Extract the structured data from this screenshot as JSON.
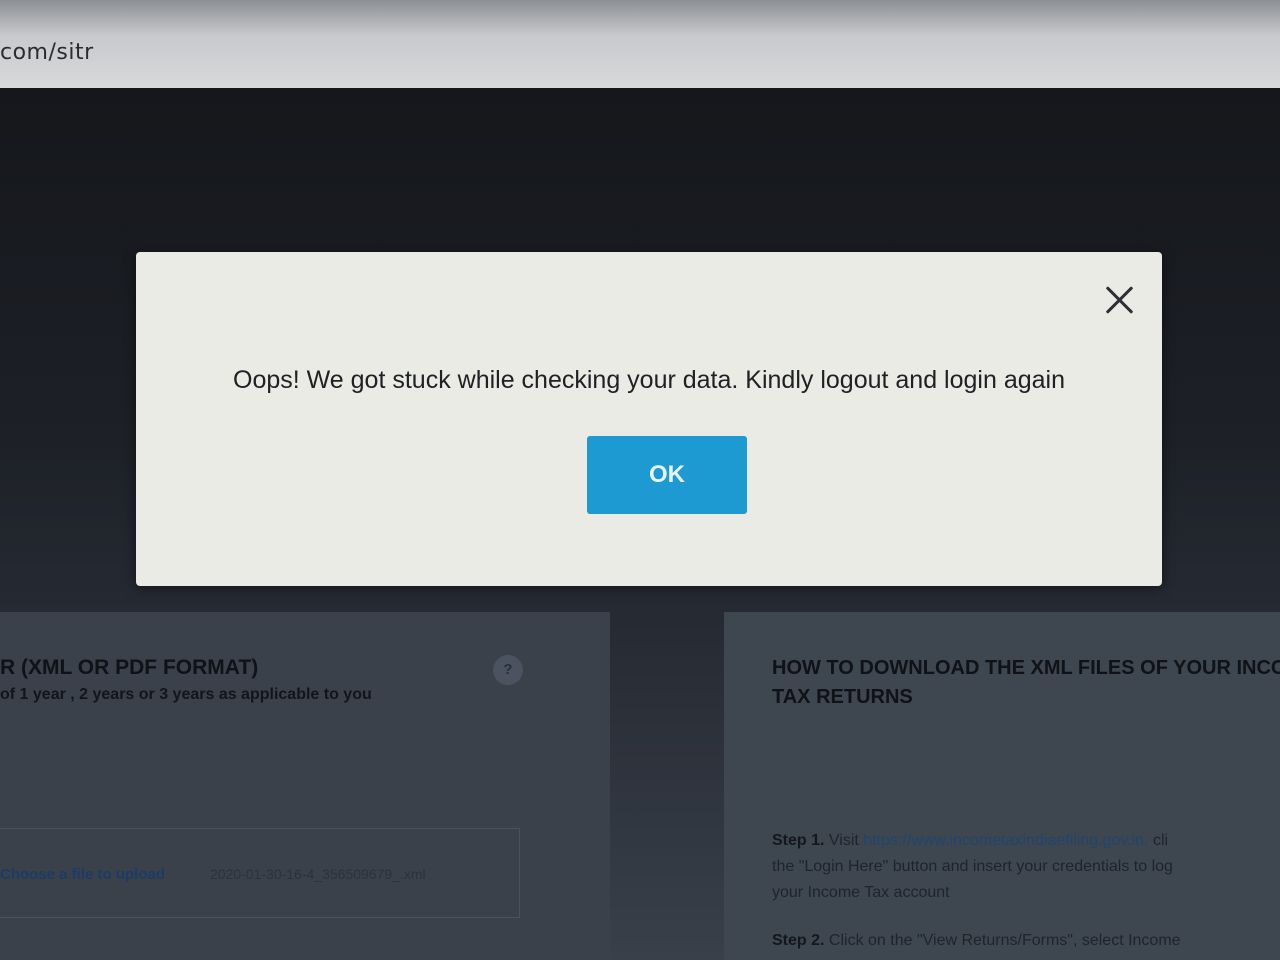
{
  "browser": {
    "url_fragment": "com/sitr"
  },
  "modal": {
    "message": "Oops! We got stuck while checking your data. Kindly logout and login again",
    "ok_label": "OK",
    "close_icon": "close-icon"
  },
  "upload_section": {
    "title": "R (XML OR PDF FORMAT)",
    "subtitle": "of 1 year , 2 years or 3 years as applicable to you",
    "help_label": "?",
    "choose_file_label": "Choose a file to upload",
    "file_name": "2020-01-30-16-4_356509679_.xml"
  },
  "howto_section": {
    "title_line1": "HOW TO DOWNLOAD THE XML FILES OF YOUR INCO",
    "title_line2": "TAX RETURNS",
    "step1_label": "Step 1.",
    "step1_text_a": "Visit",
    "step1_link": "https://www.incometaxindiaefiling.gov.in,",
    "step1_text_b": "cli",
    "step1_line2": "the \"Login Here\" button and insert your credentials to log",
    "step1_line3": "your Income Tax account",
    "step2_label": "Step 2.",
    "step2_text": "Click on the \"View Returns/Forms\", select Income"
  },
  "colors": {
    "ok_button": "#1c9ad1",
    "modal_bg": "#e9ebe4",
    "link": "#20456f"
  }
}
